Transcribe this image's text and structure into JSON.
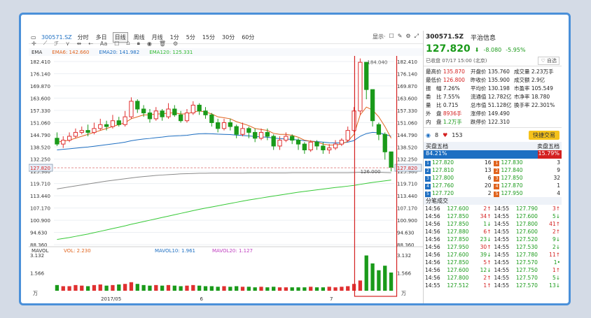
{
  "toolbar": {
    "code": "300571.SZ",
    "tabs": [
      "分时",
      "多日",
      "日线",
      "周线",
      "月线",
      "1分",
      "5分",
      "15分",
      "30分",
      "60分"
    ],
    "active": "日线",
    "display": "显示·"
  },
  "indicators": {
    "ema": "EMA",
    "ema6": "EMA6: 142.660",
    "ema20": "EMA20: 141.982",
    "ema120": "EMA120: 125.331"
  },
  "volume_bar": {
    "mavol": "MAVOL",
    "vol": "VOL: 2.230",
    "mavol10": "MAVOL10: 1.961",
    "mavol20": "MAVOL20: 1.127",
    "unit": "万"
  },
  "y_ticks": [
    "182.410",
    "176.140",
    "169.870",
    "163.600",
    "157.330",
    "151.060",
    "144.790",
    "138.520",
    "132.250",
    "125.980",
    "119.710",
    "113.440",
    "107.170",
    "100.900",
    "94.630",
    "88.360"
  ],
  "vol_ticks": [
    "3.132",
    "1.566"
  ],
  "x_ticks": [
    "2017/05",
    "6",
    "7"
  ],
  "current_price_label": "127.820",
  "annotations": {
    "high": "184.040",
    "low": "126.000"
  },
  "stock": {
    "code": "300571.SZ",
    "name": "平治信息",
    "price": "127.820",
    "arrow": "⬇",
    "change": "-8.080",
    "pct": "-5.95%",
    "status": "已收盘 07/17 15:00 (北京)",
    "follow": "自选"
  },
  "stats": [
    [
      "最高价",
      "135.870",
      "开盘价",
      "135.760",
      "成交量",
      "2.23万手"
    ],
    [
      "最低价",
      "126.800",
      "昨收价",
      "135.900",
      "成交额",
      "2.9亿"
    ],
    [
      "振　幅",
      "7.26%",
      "平均价",
      "130.198",
      "市盈率",
      "105.549"
    ],
    [
      "委　比",
      "7.55%",
      "流通值",
      "12.782亿",
      "市净率",
      "18.780"
    ],
    [
      "量　比",
      "0.715",
      "总市值",
      "51.128亿",
      "换手率",
      "22.301%"
    ],
    [
      "外　盘",
      "8936手",
      "涨停价",
      "149.490",
      "",
      ""
    ],
    [
      "内　盘",
      "1.2万手",
      "跌停价",
      "122.310",
      "",
      ""
    ]
  ],
  "follow": {
    "watchers": "8",
    "likes": "153",
    "trade": "快捷交易"
  },
  "orderbook": {
    "buy_title": "买盘五档",
    "sell_title": "卖盘五档",
    "buy_ratio": "84.21%",
    "sell_ratio": "15.79%",
    "rows": [
      [
        "1",
        "127.820",
        "16",
        "1",
        "127.830",
        "3"
      ],
      [
        "2",
        "127.810",
        "13",
        "2",
        "127.840",
        "9"
      ],
      [
        "3",
        "127.800",
        "6",
        "3",
        "127.850",
        "32"
      ],
      [
        "4",
        "127.760",
        "20",
        "4",
        "127.870",
        "1"
      ],
      [
        "5",
        "127.720",
        "2",
        "5",
        "127.950",
        "4"
      ]
    ]
  },
  "ticks_title": "分笔成交",
  "ticks": [
    [
      "14:56",
      "127.600",
      "2",
      "↑",
      "14:55",
      "127.790",
      "3",
      "↑"
    ],
    [
      "14:56",
      "127.850",
      "34",
      "↑",
      "14:55",
      "127.600",
      "5",
      "↓"
    ],
    [
      "14:56",
      "127.850",
      "1",
      "↓",
      "14:55",
      "127.800",
      "41",
      "↑"
    ],
    [
      "14:56",
      "127.880",
      "6",
      "↑",
      "14:55",
      "127.600",
      "2",
      "↑"
    ],
    [
      "14:56",
      "127.850",
      "23",
      "↓",
      "14:55",
      "127.520",
      "9",
      "↓"
    ],
    [
      "14:56",
      "127.950",
      "30",
      "↑",
      "14:55",
      "127.530",
      "2",
      "↓"
    ],
    [
      "14:56",
      "127.600",
      "39",
      "↓",
      "14:55",
      "127.780",
      "11",
      "↑"
    ],
    [
      "14:56",
      "127.850",
      "5",
      "↑",
      "14:55",
      "127.570",
      "1",
      "•"
    ],
    [
      "14:56",
      "127.600",
      "12",
      "↓",
      "14:55",
      "127.750",
      "1",
      "↑"
    ],
    [
      "14:56",
      "127.800",
      "2",
      "↑",
      "14:55",
      "127.570",
      "5",
      "↓"
    ],
    [
      "14:55",
      "127.512",
      "1",
      "↑",
      "14:55",
      "127.570",
      "13",
      "↓"
    ]
  ],
  "chart_data": {
    "type": "candlestick",
    "ylim": [
      88.36,
      182.41
    ],
    "candles": [
      [
        143,
        140,
        146,
        139
      ],
      [
        140,
        142,
        144,
        138
      ],
      [
        142,
        144,
        146,
        141
      ],
      [
        144,
        146,
        148,
        143
      ],
      [
        146,
        147,
        149,
        145
      ],
      [
        147,
        146,
        150,
        144
      ],
      [
        146,
        148,
        151,
        145
      ],
      [
        148,
        150,
        153,
        147
      ],
      [
        150,
        149,
        152,
        147
      ],
      [
        149,
        152,
        155,
        148
      ],
      [
        152,
        150,
        154,
        149
      ],
      [
        150,
        154,
        157,
        149
      ],
      [
        154,
        162,
        164,
        153
      ],
      [
        162,
        158,
        163,
        156
      ],
      [
        158,
        156,
        160,
        154
      ],
      [
        156,
        153,
        158,
        151
      ],
      [
        153,
        157,
        159,
        152
      ],
      [
        157,
        154,
        158,
        152
      ],
      [
        154,
        158,
        161,
        153
      ],
      [
        158,
        155,
        160,
        154
      ],
      [
        155,
        152,
        157,
        151
      ],
      [
        152,
        156,
        158,
        151
      ],
      [
        156,
        160,
        162,
        155
      ],
      [
        160,
        157,
        161,
        155
      ],
      [
        157,
        155,
        159,
        153
      ],
      [
        155,
        151,
        156,
        149
      ],
      [
        151,
        148,
        153,
        146
      ],
      [
        148,
        151,
        153,
        147
      ],
      [
        151,
        149,
        153,
        147
      ],
      [
        149,
        145,
        150,
        143
      ],
      [
        145,
        148,
        151,
        144
      ],
      [
        148,
        146,
        149,
        143
      ],
      [
        146,
        143,
        148,
        141
      ],
      [
        143,
        146,
        148,
        142
      ],
      [
        146,
        144,
        148,
        142
      ],
      [
        144,
        139,
        145,
        137
      ],
      [
        139,
        142,
        144,
        137
      ],
      [
        142,
        144,
        146,
        141
      ],
      [
        144,
        142,
        145,
        140
      ],
      [
        142,
        140,
        143,
        137
      ],
      [
        140,
        137,
        141,
        135
      ],
      [
        137,
        141,
        142,
        136
      ],
      [
        141,
        139,
        142,
        137
      ],
      [
        139,
        137,
        141,
        135
      ],
      [
        137,
        138,
        140,
        135
      ],
      [
        138,
        140,
        142,
        137
      ],
      [
        140,
        142,
        143,
        139
      ],
      [
        142,
        147,
        149,
        141
      ],
      [
        147,
        157,
        159,
        146
      ],
      [
        157,
        182,
        184,
        155
      ],
      [
        182,
        168,
        180,
        163
      ],
      [
        168,
        152,
        166,
        149
      ],
      [
        150,
        145,
        151,
        142
      ],
      [
        145,
        136,
        146,
        132
      ],
      [
        136,
        128,
        136,
        126
      ]
    ],
    "ema_fast": [
      141,
      141.5,
      142,
      143,
      144,
      145,
      146,
      147,
      148,
      149,
      150,
      151,
      153,
      154,
      155,
      155,
      155.5,
      155.5,
      156,
      156,
      155.5,
      155.5,
      156.5,
      157,
      156.5,
      155.5,
      154,
      153.5,
      153,
      151.5,
      150.5,
      149.5,
      148,
      147.5,
      147,
      145.5,
      145,
      145,
      144.5,
      143.5,
      142,
      141.5,
      141,
      140,
      139.5,
      139.5,
      140,
      141.5,
      145,
      155,
      159,
      157.5,
      154,
      149,
      143
    ],
    "ema_mid": [
      137,
      137.3,
      137.6,
      137.9,
      138.2,
      138.5,
      138.9,
      139.3,
      139.7,
      140.1,
      140.5,
      141,
      141.7,
      142.2,
      142.6,
      142.9,
      143.3,
      143.6,
      144,
      144.2,
      144.3,
      144.5,
      145,
      145.3,
      145.4,
      145.3,
      145.1,
      145,
      144.9,
      144.6,
      144.4,
      144.2,
      143.9,
      143.7,
      143.5,
      143.1,
      142.8,
      142.6,
      142.4,
      142.1,
      141.7,
      141.5,
      141.3,
      141,
      140.7,
      140.6,
      140.6,
      141,
      141.8,
      144,
      145.4,
      146,
      145.8,
      145,
      144
    ],
    "ema_slow": [
      117,
      117.5,
      118,
      118.5,
      119,
      119.5,
      120,
      120.5,
      121,
      121.4,
      121.8,
      122.2,
      122.6,
      123,
      123.3,
      123.6,
      123.9,
      124.1,
      124.3,
      124.5,
      124.7,
      124.8,
      124.9,
      125,
      125,
      125.1,
      125.1,
      125.1,
      125.1,
      125.1,
      125.1,
      125.2,
      125.2,
      125.2,
      125.2,
      125.2,
      125.2,
      125.2,
      125.3,
      125.3,
      125.3,
      125.3,
      125.3,
      125.3,
      125.3,
      125.3,
      125.3,
      125.3,
      125.4,
      125.5,
      125.5,
      125.5,
      125.5,
      125.4,
      125.3
    ],
    "ema_long": [
      91,
      91.5,
      92,
      92.6,
      93.2,
      93.8,
      94.5,
      95.2,
      95.9,
      96.6,
      97.3,
      98,
      98.8,
      99.5,
      100.2,
      100.9,
      101.6,
      102.3,
      103,
      103.7,
      104.4,
      105.1,
      105.8,
      106.5,
      107.1,
      107.7,
      108.3,
      108.9,
      109.5,
      110.1,
      110.7,
      111.3,
      111.8,
      112.3,
      112.8,
      113.3,
      113.8,
      114.3,
      114.8,
      115.3,
      115.7,
      116.1,
      116.5,
      116.9,
      117.3,
      117.7,
      118,
      118.4,
      118.8,
      119.3,
      119.8,
      120.3,
      120.7,
      121.1,
      121.5
    ],
    "volumes": [
      0.5,
      0.4,
      0.4,
      0.5,
      0.45,
      0.4,
      0.5,
      0.55,
      0.45,
      0.5,
      0.55,
      0.6,
      0.75,
      0.6,
      0.5,
      0.45,
      0.5,
      0.45,
      0.5,
      0.45,
      0.4,
      0.45,
      0.5,
      0.45,
      0.4,
      0.4,
      0.35,
      0.4,
      0.35,
      0.4,
      0.35,
      0.35,
      0.3,
      0.35,
      0.3,
      0.35,
      0.3,
      0.3,
      0.3,
      0.3,
      0.3,
      0.35,
      0.3,
      0.3,
      0.35,
      0.3,
      0.35,
      0.4,
      0.6,
      0.9,
      3.1,
      2.4,
      1.8,
      2.2,
      1.6
    ],
    "vol_ylim": [
      0,
      3.132
    ]
  }
}
